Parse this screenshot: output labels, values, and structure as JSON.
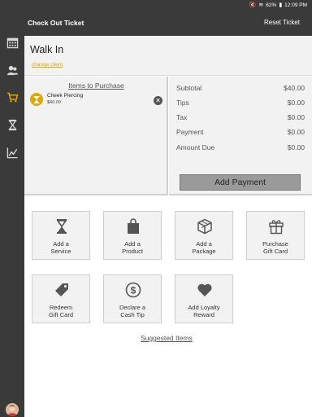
{
  "status_bar": {
    "battery": "62%",
    "time": "12:09 PM"
  },
  "app_bar": {
    "title": "Check Out Ticket",
    "reset_label": "Reset Ticket"
  },
  "client": {
    "name": "Walk In",
    "change_label": "change client"
  },
  "items": {
    "header": "Items to Purchase",
    "list": [
      {
        "name": "Cheek Piercing",
        "price": "$40.00",
        "icon": "hourglass-icon"
      }
    ]
  },
  "totals": {
    "rows": [
      {
        "label": "Subtotal",
        "value": "$40.00"
      },
      {
        "label": "Tips",
        "value": "$0.00"
      },
      {
        "label": "Tax",
        "value": "$0.00"
      },
      {
        "label": "Payment",
        "value": "$0.00"
      },
      {
        "label": "Amount Due",
        "value": "$0.00"
      }
    ],
    "add_payment_label": "Add Payment"
  },
  "actions": [
    {
      "line1": "Add a",
      "line2": "Service",
      "icon": "hourglass-icon"
    },
    {
      "line1": "Add a",
      "line2": "Product",
      "icon": "shopping-bag-icon"
    },
    {
      "line1": "Add a",
      "line2": "Package",
      "icon": "cube-icon"
    },
    {
      "line1": "Purchase",
      "line2": "Gift Card",
      "icon": "gift-icon"
    },
    {
      "line1": "Redeem",
      "line2": "Gift Card",
      "icon": "tag-icon"
    },
    {
      "line1": "Declare a",
      "line2": "Cash Tip",
      "icon": "dollar-icon"
    },
    {
      "line1": "Add Loyalty",
      "line2": "Reward",
      "icon": "heart-icon"
    }
  ],
  "suggested_label": "Suggested Items",
  "sidebar": {
    "items": [
      "calendar-icon",
      "clients-icon",
      "cart-icon",
      "hourglass-icon",
      "chart-icon"
    ],
    "active": "cart-icon"
  },
  "colors": {
    "accent": "#e0a800",
    "dark": "#3a3a3a",
    "panel": "#f2f2f2"
  }
}
